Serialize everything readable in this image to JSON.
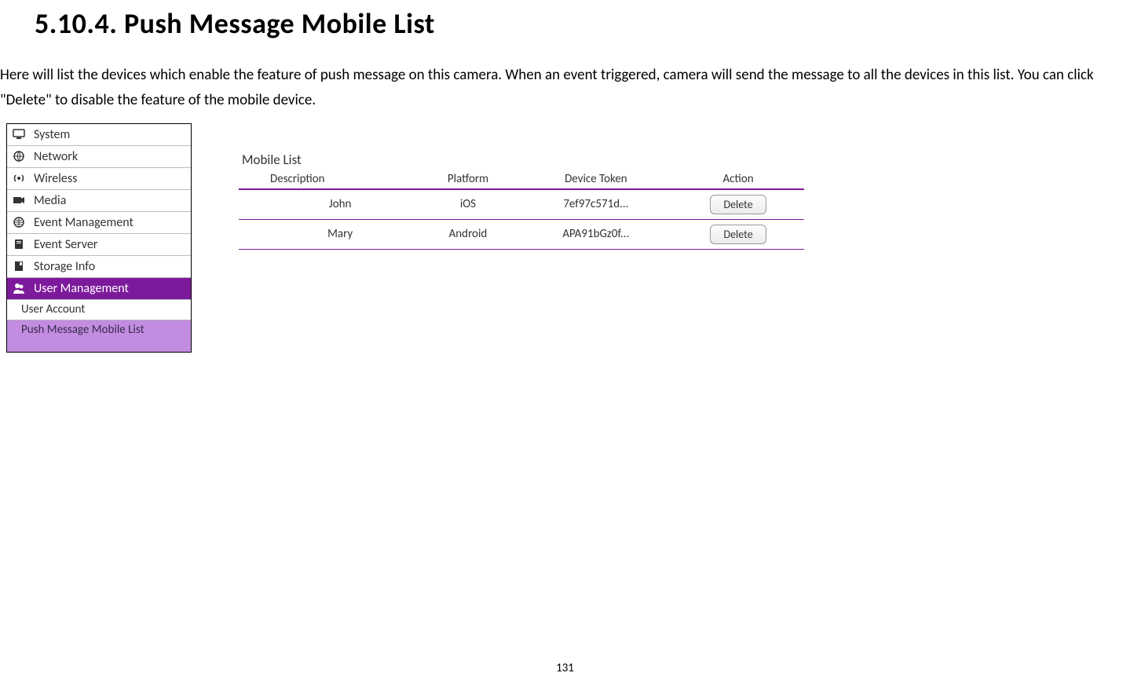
{
  "heading": "5.10.4. Push Message Mobile List",
  "description": "Here will list the devices which enable the feature of push message on this camera. When an event triggered, camera will send the message to all the devices in this list. You can click \"Delete\" to disable the feature of the mobile device.",
  "sidebar": {
    "items": [
      {
        "label": "System",
        "icon": "monitor-icon"
      },
      {
        "label": "Network",
        "icon": "globe-icon"
      },
      {
        "label": "Wireless",
        "icon": "antenna-icon"
      },
      {
        "label": "Media",
        "icon": "camera-icon"
      },
      {
        "label": "Event Management",
        "icon": "globe2-icon"
      },
      {
        "label": "Event Server",
        "icon": "server-icon"
      },
      {
        "label": "Storage Info",
        "icon": "storage-icon"
      }
    ],
    "active": {
      "label": "User Management",
      "icon": "user-icon"
    },
    "sub": [
      {
        "label": "User Account"
      },
      {
        "label": "Push Message Mobile List",
        "selected": true
      }
    ]
  },
  "mobile_list": {
    "title": "Mobile List",
    "headers": [
      "Description",
      "Platform",
      "Device Token",
      "Action"
    ],
    "rows": [
      {
        "desc": "John",
        "platform": "iOS",
        "token": "7ef97c571d...",
        "action": "Delete"
      },
      {
        "desc": "Mary",
        "platform": "Android",
        "token": "APA91bGz0f...",
        "action": "Delete"
      }
    ]
  },
  "page_number": "131"
}
